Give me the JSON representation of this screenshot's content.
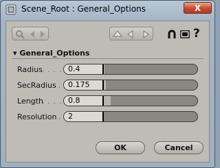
{
  "window": {
    "title": "Scene_Root : General_Options",
    "close_label": "X"
  },
  "section": {
    "title": "General_Options"
  },
  "params": [
    {
      "label": "Radius",
      "dots": ". . . .",
      "value": "0.4",
      "fill": 0.01
    },
    {
      "label": "SecRadius",
      "dots": ".",
      "value": "0.175",
      "fill": 0.02
    },
    {
      "label": "Length",
      "dots": ". . . .",
      "value": "0.8",
      "fill": 0.07
    },
    {
      "label": "Resolution",
      "dots": ".",
      "value": "2",
      "fill": 0.0
    }
  ],
  "buttons": {
    "ok": "OK",
    "cancel": "Cancel"
  },
  "icons": [
    "app-icon",
    "lock-icon",
    "prev-icon",
    "next-icon",
    "up-icon",
    "left-icon",
    "right-icon",
    "magnet-icon",
    "presets-icon",
    "help-icon"
  ]
}
